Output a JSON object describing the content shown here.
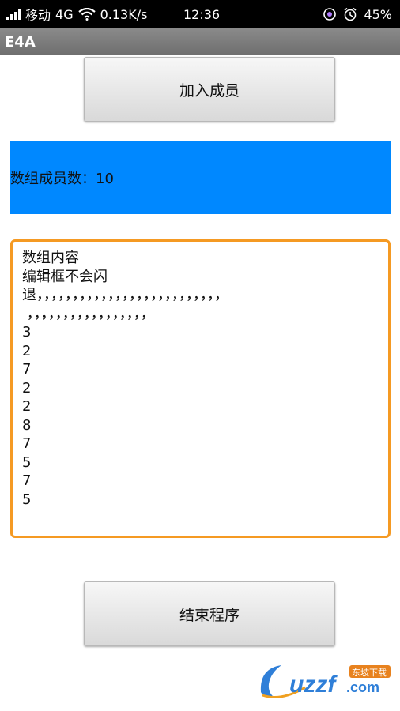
{
  "status_bar": {
    "carrier": "移动",
    "network": "4G",
    "speed": "0.13K/s",
    "time": "12:36",
    "battery": "45%",
    "icons": [
      "signal-icon",
      "wifi-icon",
      "dnd-icon",
      "alarm-icon"
    ]
  },
  "app": {
    "title": "E4A"
  },
  "buttons": {
    "add_member": "加入成员",
    "end_program": "结束程序"
  },
  "count_label": "数组成员数：10",
  "editor": {
    "lines": [
      "数组内容",
      "编辑框不会闪",
      "退，，，，，，，，，，，，，，，，，，，，，，，，，，",
      " ，，，，，，，，，，，，，，，，，",
      "3",
      "2",
      "7",
      "2",
      "2",
      "8",
      "7",
      "5",
      "7",
      "5"
    ]
  },
  "watermark": {
    "brand": "uzzf",
    "domain": ".com",
    "tag": "东坡下载"
  },
  "colors": {
    "accent_blue": "#0088ff",
    "edit_border": "#f59a23",
    "title_bar": "#777777"
  }
}
